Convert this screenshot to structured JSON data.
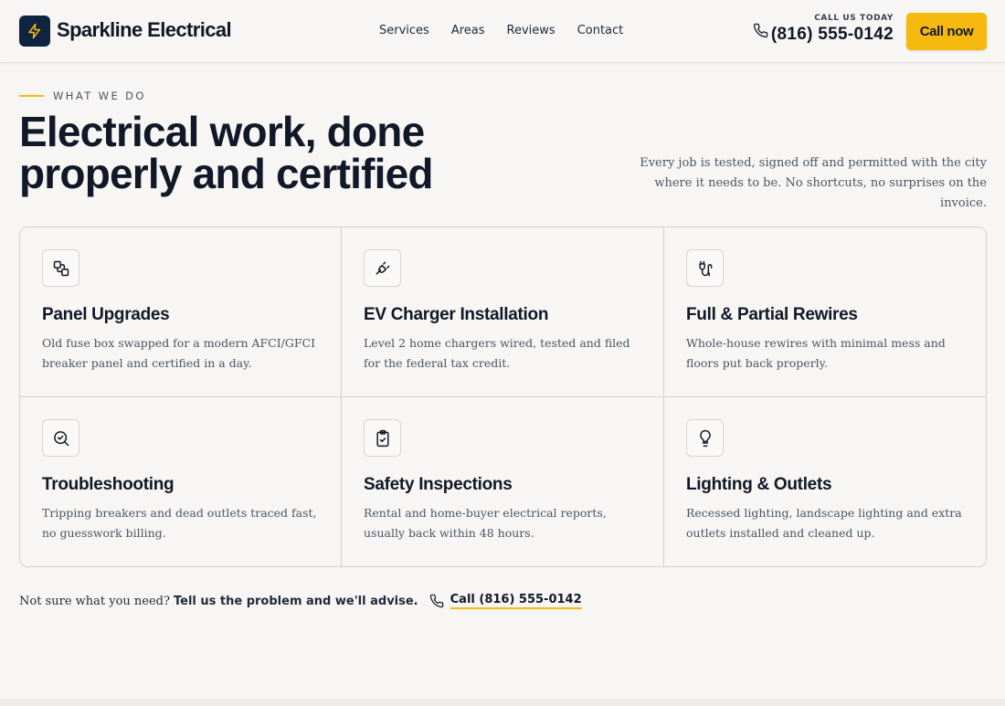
{
  "header": {
    "brand": "Sparkline Electrical",
    "nav": [
      "Services",
      "Areas",
      "Reviews",
      "Contact"
    ],
    "call_label": "CALL US TODAY",
    "phone": "(816) 555-0142",
    "cta": "Call now"
  },
  "section": {
    "eyebrow": "WHAT WE DO",
    "title": "Electrical work, done properly and certified",
    "intro": "Every job is tested, signed off and permitted with the city where it needs to be. No shortcuts, no surprises on the invoice."
  },
  "services": [
    {
      "title": "Panel Upgrades",
      "desc": "Old fuse box swapped for a modern AFCI/GFCI breaker panel and certified in a day.",
      "icon": "panel-icon"
    },
    {
      "title": "EV Charger Installation",
      "desc": "Level 2 home chargers wired, tested and filed for the federal tax credit.",
      "icon": "plug-icon"
    },
    {
      "title": "Full & Partial Rewires",
      "desc": "Whole-house rewires with minimal mess and floors put back properly.",
      "icon": "cable-icon"
    },
    {
      "title": "Troubleshooting",
      "desc": "Tripping breakers and dead outlets traced fast, no guesswork billing.",
      "icon": "search-check-icon"
    },
    {
      "title": "Safety Inspections",
      "desc": "Rental and home-buyer electrical reports, usually back within 48 hours.",
      "icon": "clipboard-check-icon"
    },
    {
      "title": "Lighting & Outlets",
      "desc": "Recessed lighting, landscape lighting and extra outlets installed and cleaned up.",
      "icon": "lightbulb-icon"
    }
  ],
  "footer": {
    "prompt": "Not sure what you need?",
    "strong": "Tell us the problem and we'll advise.",
    "link": "Call (816) 555-0142"
  },
  "colors": {
    "accent": "#f6b90f",
    "navy": "#0f2440",
    "background": "#f7f6f4"
  }
}
